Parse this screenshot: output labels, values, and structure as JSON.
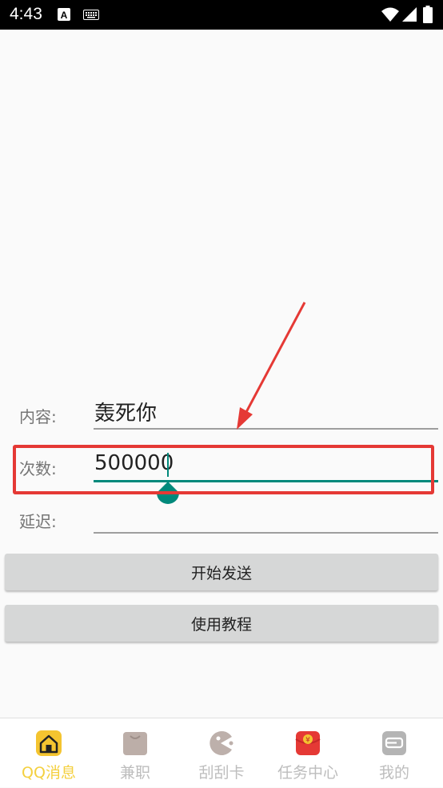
{
  "status_bar": {
    "time": "4:43",
    "icons": [
      "a-icon",
      "keyboard-icon",
      "wifi-icon",
      "signal-icon",
      "battery-icon"
    ]
  },
  "form": {
    "content_label": "内容:",
    "content_value": "轰死你",
    "count_label": "次数:",
    "count_value": "500000",
    "delay_label": "延迟:",
    "delay_value": ""
  },
  "buttons": {
    "start_label": "开始发送",
    "tutorial_label": "使用教程"
  },
  "bottom_nav": {
    "items": [
      {
        "label": "QQ消息",
        "icon": "house-icon",
        "active": true
      },
      {
        "label": "兼职",
        "icon": "bag-icon",
        "active": false
      },
      {
        "label": "刮刮卡",
        "icon": "pacman-icon",
        "active": false
      },
      {
        "label": "任务中心",
        "icon": "red-envelope-icon",
        "active": false
      },
      {
        "label": "我的",
        "icon": "profile-icon",
        "active": false
      }
    ]
  },
  "colors": {
    "accent": "#00897b",
    "highlight": "#e53935",
    "active_tab": "#f4d03f",
    "inactive_tab": "#bdbdbd",
    "button_bg": "#d6d7d7"
  }
}
